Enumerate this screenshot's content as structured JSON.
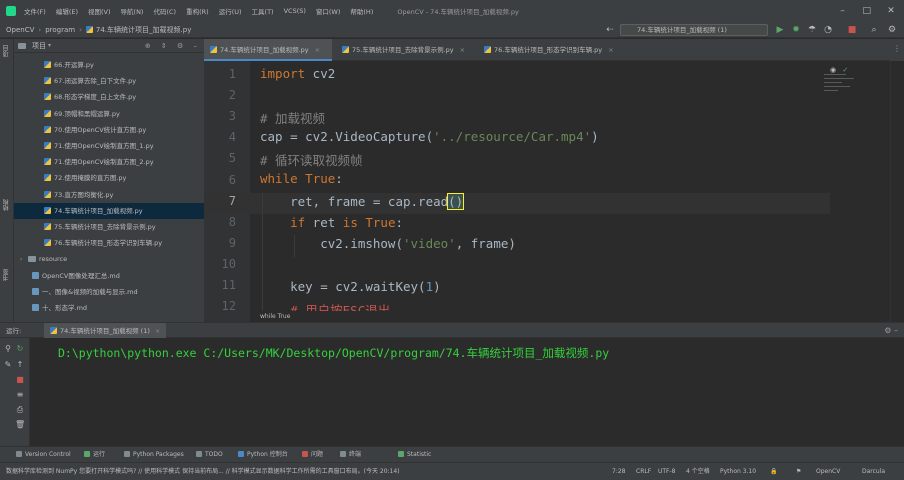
{
  "menubar": {
    "items": [
      "文件(F)",
      "编辑(E)",
      "视图(V)",
      "导航(N)",
      "代码(C)",
      "重构(R)",
      "运行(U)",
      "工具(T)",
      "VCS(S)",
      "窗口(W)",
      "帮助(H)"
    ],
    "window_title": "OpenCV - 74.车辆统计项目_加载视频.py"
  },
  "navbar": {
    "crumbs": [
      "OpenCV",
      "program",
      "74.车辆统计项目_加载视频.py"
    ],
    "run_config": "74.车辆统计项目_加载视频 (1)"
  },
  "sidebar": {
    "project_label": "项目",
    "structure_label": "结构",
    "bookmarks_label": "书签"
  },
  "project": {
    "title": "项目",
    "items": [
      {
        "label": "66.开运算.py",
        "type": "py"
      },
      {
        "label": "67.闭运算去除_白下文件.py",
        "type": "py"
      },
      {
        "label": "68.形态学梯度_白上文件.py",
        "type": "py"
      },
      {
        "label": "69.顶帽和黑帽运算.py",
        "type": "py"
      },
      {
        "label": "70.使用OpenCV统计直方图.py",
        "type": "py"
      },
      {
        "label": "71.使用OpenCV绘制直方图_1.py",
        "type": "py"
      },
      {
        "label": "71.使用OpenCV绘制直方图_2.py",
        "type": "py"
      },
      {
        "label": "72.使用掩膜的直方图.py",
        "type": "py"
      },
      {
        "label": "73.直方图均衡化.py",
        "type": "py"
      },
      {
        "label": "74.车辆统计项目_加载视频.py",
        "type": "py",
        "selected": true
      },
      {
        "label": "75.车辆统计项目_去除背景示例.py",
        "type": "py"
      },
      {
        "label": "76.车辆统计项目_形态学识别车辆.py",
        "type": "py"
      },
      {
        "label": "resource",
        "type": "folder"
      },
      {
        "label": "OpenCV图像处理汇总.md",
        "type": "md"
      },
      {
        "label": "一、图像&视频的加载与显示.md",
        "type": "md"
      },
      {
        "label": "十、形态学.md",
        "type": "md"
      }
    ]
  },
  "editor": {
    "tabs": [
      {
        "label": "74.车辆统计项目_加载视频.py",
        "active": true
      },
      {
        "label": "75.车辆统计项目_去除背景示例.py",
        "active": false
      },
      {
        "label": "76.车辆统计项目_形态学识别车辆.py",
        "active": false
      }
    ],
    "line_numbers": [
      "1",
      "2",
      "3",
      "4",
      "5",
      "6",
      "7",
      "8",
      "9",
      "10",
      "11",
      "12"
    ],
    "current_line": "7",
    "code": {
      "l1_kw": "import",
      "l1_rest": " cv2",
      "l3": "# 加载视频",
      "l4_a": "cap = cv2.VideoCapture(",
      "l4_str": "'../resource/Car.mp4'",
      "l4_b": ")",
      "l5": "# 循环读取视频帧",
      "l6_kw": "while",
      "l6_bool": "True",
      "l6_b": ":",
      "l7_a": "    ret, frame = cap.read",
      "l7_paren": "()",
      "l8_kw": "    if",
      "l8_a": " ret ",
      "l8_kw2": "is",
      "l8_bool": " True",
      "l8_b": ":",
      "l9_a": "        cv2.imshow(",
      "l9_str": "'video'",
      "l9_b": ", frame)",
      "l11_a": "    key = cv2.waitKey(",
      "l11_num": "1",
      "l11_b": ")",
      "l12": "    # 用户按ESC退出"
    },
    "scope": "while True"
  },
  "run": {
    "tab_label": "74.车辆统计项目_加载视频 (1)",
    "label": "运行:",
    "command": "D:\\python\\python.exe C:/Users/MK/Desktop/OpenCV/program/74.车辆统计项目_加载视频.py"
  },
  "bottom_tabs": [
    "Version Control",
    "运行",
    "Python Packages",
    "TODO",
    "Python 控制台",
    "问题",
    "终端",
    "Statistic"
  ],
  "statusbar": {
    "message": "数据科学库检测到 NumPy 您要打开科学模式吗? // 使用科学模式  保持当前布局... // 科学模式显示数据科学工作所需的工具窗口布局。(今天 20:14)",
    "position": "7:28",
    "line_sep": "CRLF",
    "encoding": "UTF-8",
    "indent": "4 个空格",
    "interpreter": "Python 3.10",
    "project": "OpenCV",
    "theme": "Darcula"
  }
}
